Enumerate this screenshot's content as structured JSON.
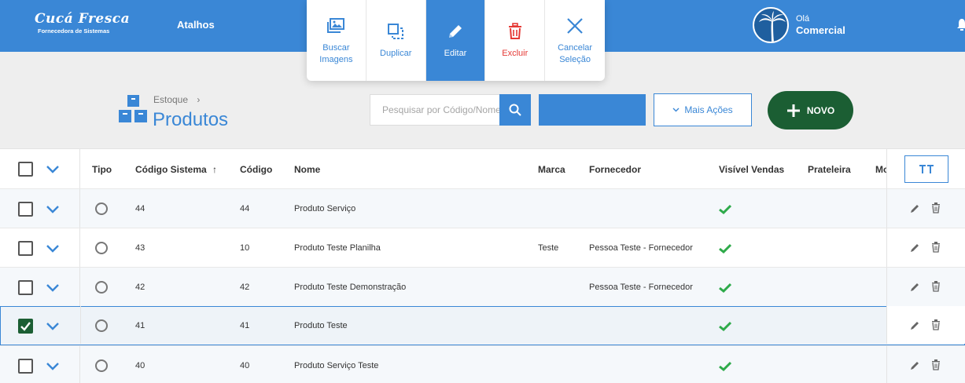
{
  "header": {
    "logo_main": "Cucá Fresca",
    "logo_sub": "Fornecedora de Sistemas",
    "nav_label": "Atalhos",
    "greeting": "Olá",
    "user_name": "Comercial"
  },
  "action_bar": [
    {
      "label": "Buscar Imagens",
      "icon": "image-icon"
    },
    {
      "label": "Duplicar",
      "icon": "duplicate-icon"
    },
    {
      "label": "Editar",
      "icon": "pencil-icon"
    },
    {
      "label": "Excluir",
      "icon": "trash-icon"
    },
    {
      "label": "Cancelar Seleção",
      "icon": "close-icon"
    }
  ],
  "breadcrumb": {
    "parent": "Estoque",
    "separator": "›",
    "title": "Produtos"
  },
  "search": {
    "placeholder": "Pesquisar por Código/Nome"
  },
  "buttons": {
    "more_actions": "Mais Ações",
    "new": "NOVO"
  },
  "table": {
    "columns": [
      "Tipo",
      "Código Sistema",
      "Código",
      "Nome",
      "Marca",
      "Fornecedor",
      "Visível Vendas",
      "Prateleira",
      "Mo"
    ],
    "sort_indicator": "↑",
    "rows": [
      {
        "codigo_sistema": "44",
        "codigo": "44",
        "nome": "Produto Serviço",
        "marca": "",
        "fornecedor": "",
        "visivel": true,
        "selected": false
      },
      {
        "codigo_sistema": "43",
        "codigo": "10",
        "nome": "Produto Teste Planilha",
        "marca": "Teste",
        "fornecedor": "Pessoa Teste - Fornecedor",
        "visivel": true,
        "selected": false
      },
      {
        "codigo_sistema": "42",
        "codigo": "42",
        "nome": "Produto Teste Demonstração",
        "marca": "",
        "fornecedor": "Pessoa Teste - Fornecedor",
        "visivel": true,
        "selected": false
      },
      {
        "codigo_sistema": "41",
        "codigo": "41",
        "nome": "Produto Teste",
        "marca": "",
        "fornecedor": "",
        "visivel": true,
        "selected": true
      },
      {
        "codigo_sistema": "40",
        "codigo": "40",
        "nome": "Produto Serviço Teste",
        "marca": "",
        "fornecedor": "",
        "visivel": true,
        "selected": false
      }
    ]
  },
  "colors": {
    "primary": "#3a87d6",
    "success": "#1b5e33",
    "danger": "#e53935",
    "check": "#2eaa4a"
  }
}
